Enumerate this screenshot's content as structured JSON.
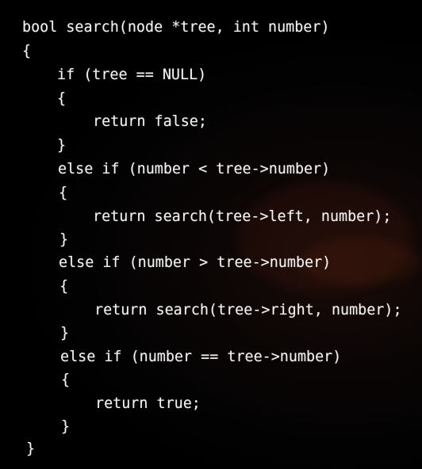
{
  "code": {
    "language": "c",
    "lines": [
      "bool search(node *tree, int number)",
      "{",
      "if (tree == NULL)",
      "{",
      "return false;",
      "}",
      "else if (number < tree->number)",
      "{",
      "return search(tree->left, number);",
      "}",
      "else if (number > tree->number)",
      "{",
      "return search(tree->right, number);",
      "}",
      "else if (number == tree->number)",
      "{",
      "return true;",
      "}",
      "}"
    ]
  },
  "colors": {
    "background": "#000000",
    "text": "#f2f2f2"
  }
}
